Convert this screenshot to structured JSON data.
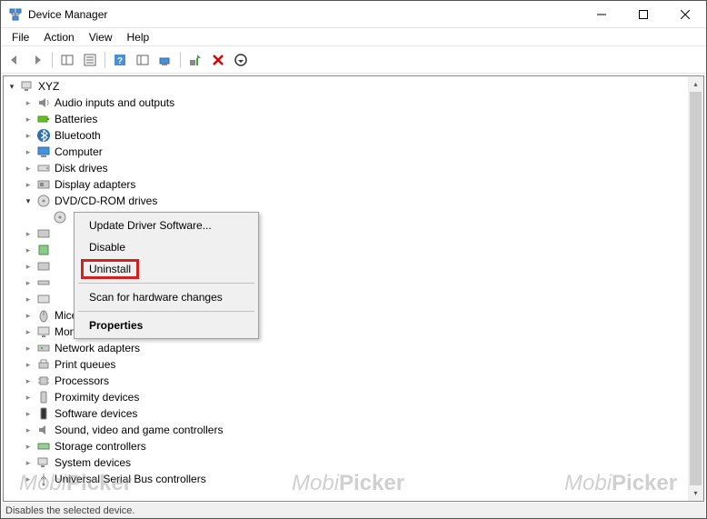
{
  "title": "Device Manager",
  "menubar": [
    "File",
    "Action",
    "View",
    "Help"
  ],
  "root": "XYZ",
  "categories": [
    {
      "label": "Audio inputs and outputs"
    },
    {
      "label": "Batteries"
    },
    {
      "label": "Bluetooth"
    },
    {
      "label": "Computer"
    },
    {
      "label": "Disk drives"
    },
    {
      "label": "Display adapters"
    },
    {
      "label": "DVD/CD-ROM drives",
      "expanded": true
    },
    {
      "label": ""
    },
    {
      "label": ""
    },
    {
      "label": ""
    },
    {
      "label": ""
    },
    {
      "label": ""
    },
    {
      "label": ""
    },
    {
      "label": "Mice and other pointing devices"
    },
    {
      "label": "Monitors"
    },
    {
      "label": "Network adapters"
    },
    {
      "label": "Print queues"
    },
    {
      "label": "Processors"
    },
    {
      "label": "Proximity devices"
    },
    {
      "label": "Software devices"
    },
    {
      "label": "Sound, video and game controllers"
    },
    {
      "label": "Storage controllers"
    },
    {
      "label": "System devices"
    },
    {
      "label": "Universal Serial Bus controllers"
    }
  ],
  "context_menu": {
    "items": [
      {
        "label": "Update Driver Software..."
      },
      {
        "label": "Disable"
      },
      {
        "label": "Uninstall",
        "highlighted": true
      },
      {
        "sep": true
      },
      {
        "label": "Scan for hardware changes"
      },
      {
        "sep": true
      },
      {
        "label": "Properties",
        "bold": true
      }
    ]
  },
  "statusbar": "Disables the selected device.",
  "watermark": "MobiPicker"
}
